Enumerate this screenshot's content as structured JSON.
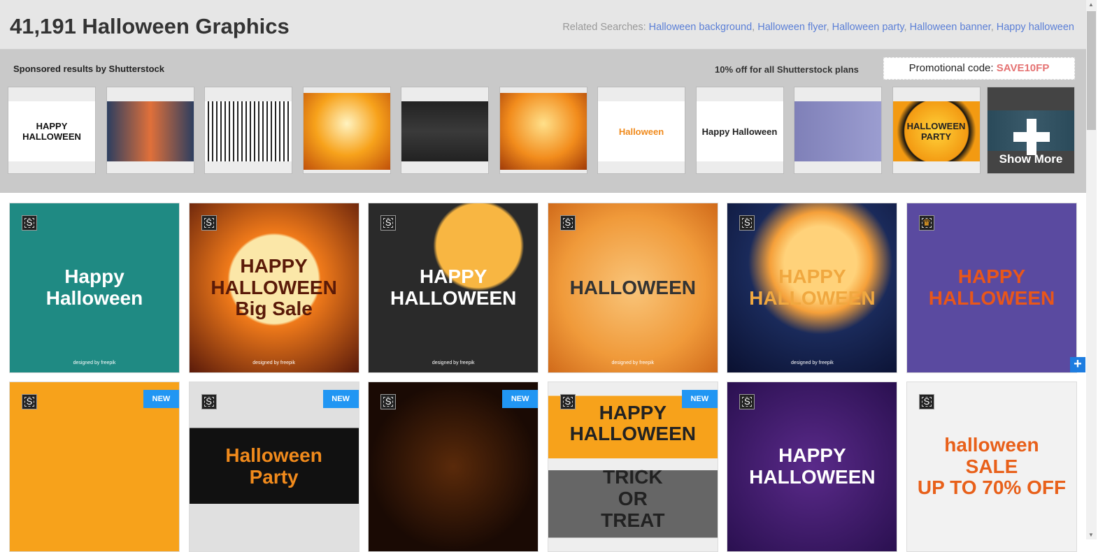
{
  "header": {
    "title": "41,191 Halloween Graphics",
    "related_label": "Related Searches:",
    "related": [
      "Halloween background",
      "Halloween flyer",
      "Halloween party",
      "Halloween banner",
      "Happy halloween"
    ]
  },
  "sponsored": {
    "label": "Sponsored results by Shutterstock",
    "offer": "10% off for all Shutterstock plans",
    "promo_label": "Promotional code:",
    "promo_code": "SAVE10FP",
    "show_more": "Show More",
    "thumbs": [
      {
        "art": "HAPPY HALLOWEEN",
        "bg": "#ffffff",
        "fg": "#111"
      },
      {
        "art": "",
        "bg": "linear-gradient(90deg,#2c3e60,#e0703a,#2c3e60)",
        "fg": "#fff"
      },
      {
        "art": "",
        "bg": "repeating-linear-gradient(90deg,#fff 0 4px,#222 4px 6px)",
        "fg": "#111"
      },
      {
        "art": "",
        "bg": "radial-gradient(circle at 50% 40%,#fff3c0,#f7a21b 50%,#c0500a)",
        "fg": "#fff"
      },
      {
        "art": "",
        "bg": "linear-gradient(#222,#3a3a3a,#222)",
        "fg": "#fff"
      },
      {
        "art": "",
        "bg": "radial-gradient(circle at 50% 40%,#ffe08a,#f28c1c 55%,#a03a08)",
        "fg": "#fff"
      },
      {
        "art": "Halloween",
        "bg": "#ffffff",
        "fg": "#f08a1c"
      },
      {
        "art": "Happy Halloween",
        "bg": "#ffffff",
        "fg": "#222"
      },
      {
        "art": "",
        "bg": "linear-gradient(90deg,#7f80b8,#9b9dd0)",
        "fg": "#fff"
      },
      {
        "art": "HALLOWEEN PARTY",
        "bg": "radial-gradient(circle,#ffd23a,#f39a12 60%,#111 62%,#f39a12 75%)",
        "fg": "#222"
      }
    ]
  },
  "cards": [
    {
      "art": "Happy\nHalloween",
      "bg": "#1f8a83",
      "fg": "#fff",
      "badge": "S",
      "new": false,
      "credit": "designed by freepik"
    },
    {
      "art": "HAPPY\nHALLOWEEN\nBig Sale",
      "bg": "radial-gradient(circle at 50% 45%,#fbe7a8 35%,#f07a1a 37%,#5a1a0a)",
      "fg": "#5a1a08",
      "badge": "S",
      "new": false,
      "credit": "designed by freepik"
    },
    {
      "art": "HAPPY\nHALLOWEEN",
      "bg": "radial-gradient(circle at 65% 25%,#f8b642 25%,#2a2a2a 27%)",
      "fg": "#fff",
      "badge": "S",
      "new": false,
      "credit": "designed by freepik"
    },
    {
      "art": "HALLOWEEN",
      "bg": "radial-gradient(circle,#f9c57a,#f09a3a 60%,#d06a1a)",
      "fg": "#333",
      "badge": "S",
      "new": false,
      "credit": "designed by freepik"
    },
    {
      "art": "HAPPY\nHALLOWEEN",
      "bg": "radial-gradient(circle at 55% 35%,#ffd27a 25%,#f5a03a 35%,#1a2a5a 50%,#0a1030)",
      "fg": "#f0a840",
      "badge": "S",
      "new": false,
      "credit": "designed by freepik"
    },
    {
      "art": "HAPPY\nHALLOWEEN",
      "bg": "#5a4aa0",
      "fg": "#e8561a",
      "badge": "crown",
      "new": false,
      "credit": ""
    },
    {
      "art": "",
      "bg": "#f7a21b",
      "fg": "#5a2a08",
      "badge": "S",
      "new": true,
      "credit": ""
    },
    {
      "art": "Halloween\nParty",
      "bg": "linear-gradient(#e0e0e0 0 27%,#111 27% 72%,#e0e0e0 72%)",
      "fg": "#f08a1c",
      "badge": "S",
      "new": true,
      "credit": ""
    },
    {
      "art": "",
      "bg": "radial-gradient(circle,#5a2a0a,#1a0a04 70%)",
      "fg": "#f0a040",
      "badge": "S",
      "new": true,
      "credit": ""
    },
    {
      "art": "HAPPY\nHALLOWEEN\n\nTRICK\nOR\nTREAT",
      "bg": "linear-gradient(#eee 0 8%,#f7a21b 8% 45%,#eee 45% 52%,#666 52% 92%,#eee 92%)",
      "fg": "#222",
      "badge": "S",
      "new": true,
      "credit": ""
    },
    {
      "art": "HAPPY\nHALLOWEEN",
      "bg": "radial-gradient(circle,#5a2a8a,#2a1050)",
      "fg": "#fff",
      "badge": "S",
      "new": false,
      "credit": ""
    },
    {
      "art": "halloween\nSALE\nUP TO 70% OFF",
      "bg": "#f2f2f2",
      "fg": "#e8601a",
      "badge": "S",
      "new": false,
      "credit": ""
    }
  ],
  "new_label": "NEW",
  "colors": {
    "accent": "#2196f3",
    "promo": "#e57373",
    "link": "#5b7fd6"
  }
}
